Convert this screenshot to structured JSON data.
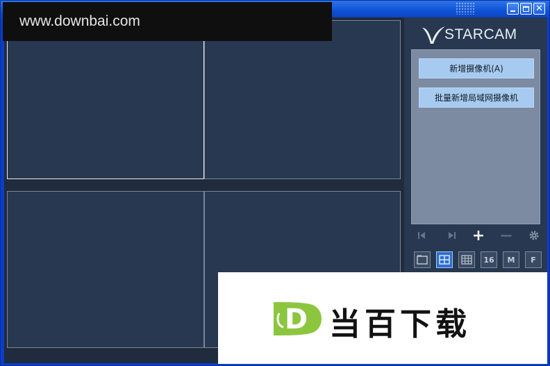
{
  "window": {
    "controls": [
      "minimize",
      "maximize",
      "close"
    ]
  },
  "brand": {
    "logo_text": "STARCAM"
  },
  "sidebar": {
    "add_camera_label": "新增摄像机(A)",
    "batch_add_lan_label": "批量新增局域网摄像机"
  },
  "controls": {
    "prev": "first-page-icon",
    "next": "last-page-icon",
    "add": "+",
    "remove": "−",
    "settings": "gear-icon"
  },
  "layouts": {
    "single": "1x1",
    "quad": "2x2",
    "nine": "3x3",
    "sixteen_label": "16",
    "multi_label": "M",
    "full_label": "F",
    "active": "quad"
  },
  "watermark": {
    "site_url": "www.downbai.com",
    "brand_name": "当百下载",
    "brand_letter": "D"
  },
  "colors": {
    "titlebar": "#0f52d6",
    "pane_bg": "#283850",
    "sidebar_button": "#a7cbf0",
    "camera_list_bg": "#7c8aa2",
    "watermark_green": "#8cc63f"
  }
}
